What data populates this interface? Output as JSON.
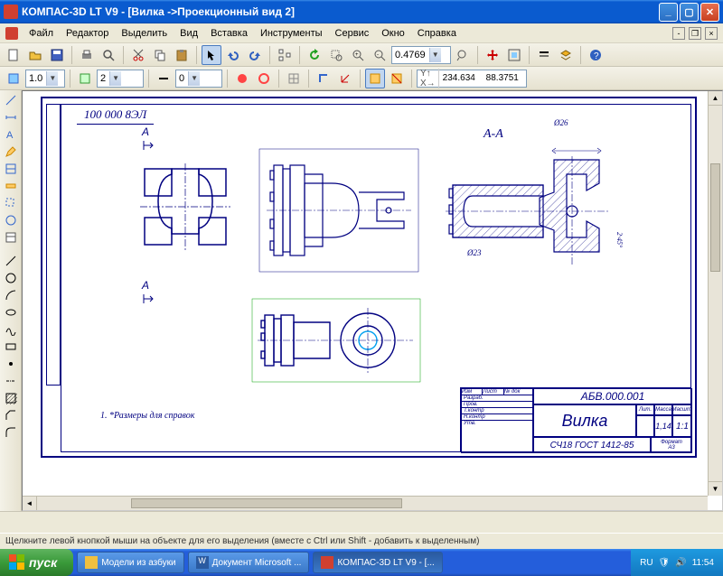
{
  "window": {
    "title": "КОМПАС-3D LT V9 - [Вилка ->Проекционный вид 2]"
  },
  "menu": {
    "items": [
      "Файл",
      "Редактор",
      "Выделить",
      "Вид",
      "Вставка",
      "Инструменты",
      "Сервис",
      "Окно",
      "Справка"
    ]
  },
  "toolbar1": {
    "zoom_value": "0.4769"
  },
  "toolbar2": {
    "scale": "1.0",
    "layer": "2",
    "style": "0",
    "coord_x_label": "X:",
    "coord_y_label": "Y:",
    "coord_x": "234.634",
    "coord_y": "88.3751"
  },
  "drawing": {
    "drawing_number_top": "100 000 8ЭЛ",
    "section_marker_a": "А",
    "section_label": "А-А",
    "dim1": "Ø26",
    "dim2": "Ø23",
    "dim3": "2·45°",
    "note": "1. *Размеры для справок",
    "title_block": {
      "drawing_no": "АБВ.000.001",
      "name": "Вилка",
      "material": "СЧ18 ГОСТ 1412-85",
      "scale_label": "Масшт.",
      "scale": "1:1",
      "sheet_label": "Лист",
      "mass_label": "Масса",
      "lit_label": "Лит.",
      "mass": "1,14",
      "format_label": "Формат",
      "format": "А3"
    }
  },
  "status": {
    "hint": "Щелкните левой кнопкой мыши на объекте для его выделения (вместе с Ctrl или Shift - добавить к выделенным)"
  },
  "taskbar": {
    "start": "пуск",
    "tasks": [
      "Модели из азбуки",
      "Документ Microsoft ...",
      "КОМПАС-3D LT V9 - [..."
    ],
    "lang": "RU",
    "time": "11:54"
  }
}
